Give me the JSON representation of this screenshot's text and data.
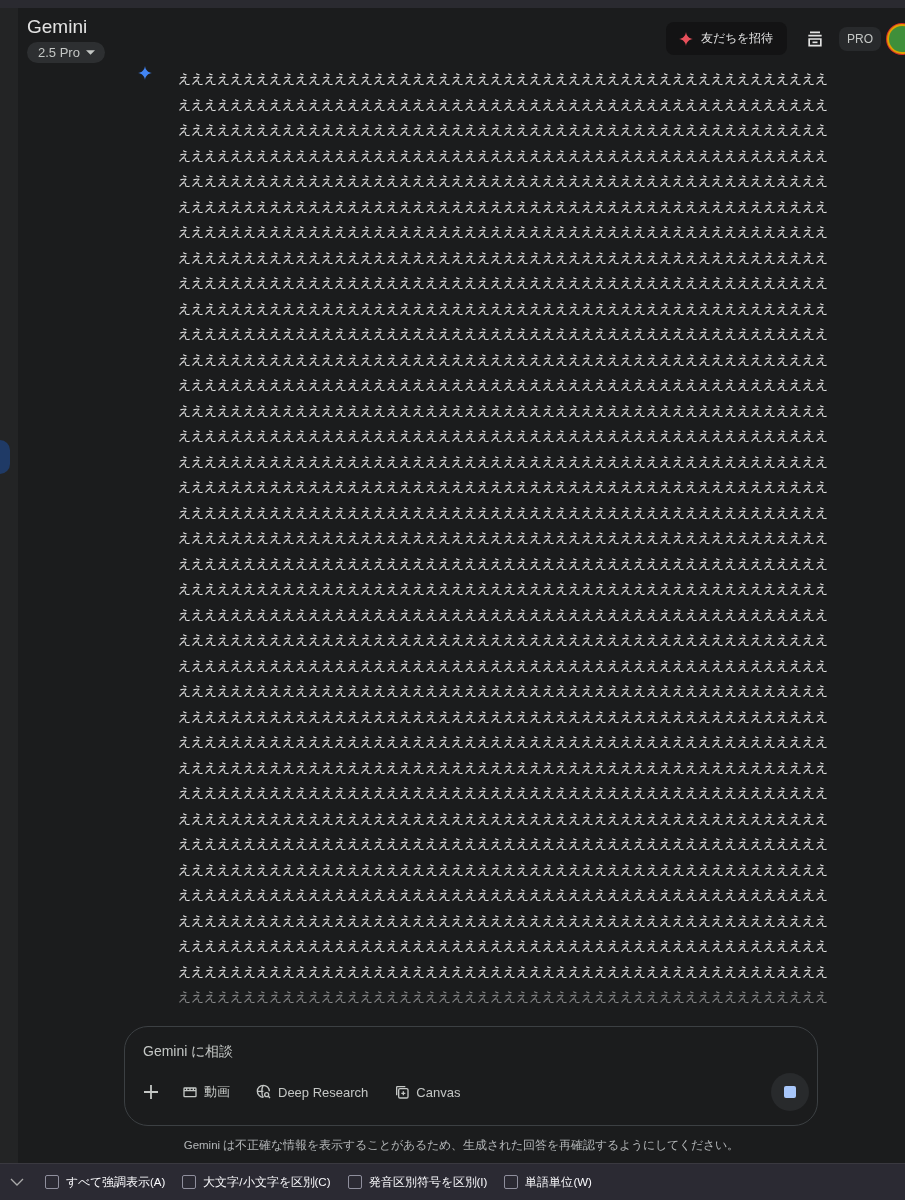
{
  "header": {
    "title": "Gemini",
    "model": "2.5 Pro",
    "invite": "友だちを招待",
    "plan_badge": "PRO"
  },
  "response": {
    "lines": [
      "ええええええええええええええええええええええええええええええええええええええええええええええええええ",
      "ええええええええええええええええええええええええええええええええええええええええええええええええええ",
      "ええええええええええええええええええええええええええええええええええええええええええええええええええ",
      "ええええええええええええええええええええええええええええええええええええええええええええええええええ",
      "ええええええええええええええええええええええええええええええええええええええええええええええええええ",
      "ええええええええええええええええええええええええええええええええええええええええええええええええええ",
      "ええええええええええええええええええええええええええええええええええええええええええええええええええ",
      "ええええええええええええええええええええええええええええええええええええええええええええええええええ",
      "ええええええええええええええええええええええええええええええええええええええええええええええええええ",
      "ええええええええええええええええええええええええええええええええええええええええええええええええええ",
      "ええええええええええええええええええええええええええええええええええええええええええええええええええ",
      "ええええええええええええええええええええええええええええええええええええええええええええええええええ",
      "ええええええええええええええええええええええええええええええええええええええええええええええええええ",
      "ええええええええええええええええええええええええええええええええええええええええええええええええええ",
      "ええええええええええええええええええええええええええええええええええええええええええええええええええ",
      "ええええええええええええええええええええええええええええええええええええええええええええええええええ",
      "ええええええええええええええええええええええええええええええええええええええええええええええええええ",
      "ええええええええええええええええええええええええええええええええええええええええええええええええええ",
      "ええええええええええええええええええええええええええええええええええええええええええええええええええ",
      "ええええええええええええええええええええええええええええええええええええええええええええええええええ",
      "ええええええええええええええええええええええええええええええええええええええええええええええええええ",
      "ええええええええええええええええええええええええええええええええええええええええええええええええええ",
      "ええええええええええええええええええええええええええええええええええええええええええええええええええ",
      "ええええええええええええええええええええええええええええええええええええええええええええええええええ",
      "ええええええええええええええええええええええええええええええええええええええええええええええええええ",
      "ええええええええええええええええええええええええええええええええええええええええええええええええええ",
      "ええええええええええええええええええええええええええええええええええええええええええええええええええ",
      "ええええええええええええええええええええええええええええええええええええええええええええええええええ",
      "ええええええええええええええええええええええええええええええええええええええええええええええええええ",
      "ええええええええええええええええええええええええええええええええええええええええええええええええええ",
      "ええええええええええええええええええええええええええええええええええええええええええええええええええ",
      "ええええええええええええええええええええええええええええええええええええええええええええええええええ",
      "ええええええええええええええええええええええええええええええええええええええええええええええええええ",
      "ええええええええええええええええええええええええええええええええええええええええええええええええええ",
      "ええええええええええええええええええええええええええええええええええええええええええええええええええ",
      "ええええええええええええええええええええええええええええええええええええええええええええええええええ",
      "ええええええええええええええええええええええええええええええええええええええええええええええええええ"
    ]
  },
  "composer": {
    "placeholder": "Gemini に相談",
    "generating": true,
    "tools": [
      {
        "label": "動画",
        "kind": "video"
      },
      {
        "label": "Deep Research",
        "kind": "research"
      },
      {
        "label": "Canvas",
        "kind": "canvas"
      }
    ]
  },
  "disclaimer": "Gemini は不正確な情報を表示することがあるため、生成された回答を再確認するようにしてください。",
  "find_bar": {
    "options": [
      {
        "label": "すべて強調表示(A)",
        "checked": false
      },
      {
        "label": "大文字/小文字を区別(C)",
        "checked": false
      },
      {
        "label": "発音区別符号を区別(I)",
        "checked": false
      },
      {
        "label": "単語単位(W)",
        "checked": false
      }
    ]
  }
}
